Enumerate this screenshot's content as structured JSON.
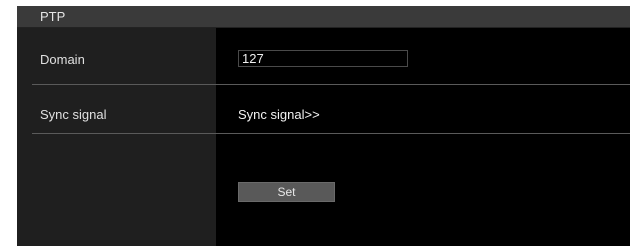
{
  "section": {
    "title": "PTP"
  },
  "rows": {
    "domain": {
      "label": "Domain",
      "value": "127"
    },
    "sync_signal": {
      "label": "Sync signal",
      "link_text": "Sync signal>>"
    }
  },
  "actions": {
    "set_label": "Set"
  }
}
